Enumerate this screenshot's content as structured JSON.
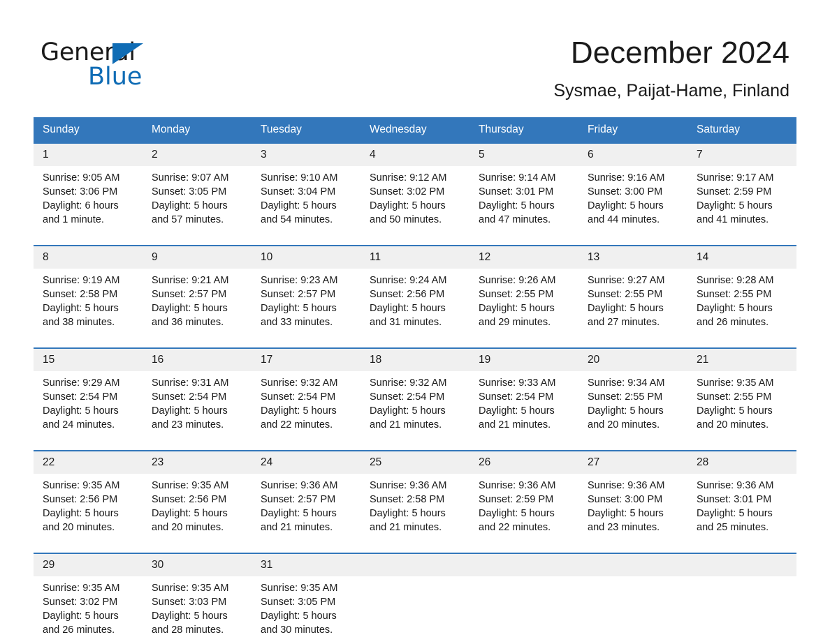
{
  "brand": {
    "name_part1": "General",
    "name_part2": "Blue",
    "triangle_icon": "blue-triangle-icon",
    "accent_color": "#0f6cb5"
  },
  "header": {
    "title": "December 2024",
    "location": "Sysmae, Paijat-Hame, Finland"
  },
  "colors": {
    "header_blue": "#3377bb",
    "daynum_gray": "#f0f0f0",
    "text": "#1a1a1a"
  },
  "calendar": {
    "weekdays": [
      "Sunday",
      "Monday",
      "Tuesday",
      "Wednesday",
      "Thursday",
      "Friday",
      "Saturday"
    ],
    "weeks": [
      [
        {
          "day": "1",
          "sunrise": "Sunrise: 9:05 AM",
          "sunset": "Sunset: 3:06 PM",
          "daylight_line1": "Daylight: 6 hours",
          "daylight_line2": "and 1 minute."
        },
        {
          "day": "2",
          "sunrise": "Sunrise: 9:07 AM",
          "sunset": "Sunset: 3:05 PM",
          "daylight_line1": "Daylight: 5 hours",
          "daylight_line2": "and 57 minutes."
        },
        {
          "day": "3",
          "sunrise": "Sunrise: 9:10 AM",
          "sunset": "Sunset: 3:04 PM",
          "daylight_line1": "Daylight: 5 hours",
          "daylight_line2": "and 54 minutes."
        },
        {
          "day": "4",
          "sunrise": "Sunrise: 9:12 AM",
          "sunset": "Sunset: 3:02 PM",
          "daylight_line1": "Daylight: 5 hours",
          "daylight_line2": "and 50 minutes."
        },
        {
          "day": "5",
          "sunrise": "Sunrise: 9:14 AM",
          "sunset": "Sunset: 3:01 PM",
          "daylight_line1": "Daylight: 5 hours",
          "daylight_line2": "and 47 minutes."
        },
        {
          "day": "6",
          "sunrise": "Sunrise: 9:16 AM",
          "sunset": "Sunset: 3:00 PM",
          "daylight_line1": "Daylight: 5 hours",
          "daylight_line2": "and 44 minutes."
        },
        {
          "day": "7",
          "sunrise": "Sunrise: 9:17 AM",
          "sunset": "Sunset: 2:59 PM",
          "daylight_line1": "Daylight: 5 hours",
          "daylight_line2": "and 41 minutes."
        }
      ],
      [
        {
          "day": "8",
          "sunrise": "Sunrise: 9:19 AM",
          "sunset": "Sunset: 2:58 PM",
          "daylight_line1": "Daylight: 5 hours",
          "daylight_line2": "and 38 minutes."
        },
        {
          "day": "9",
          "sunrise": "Sunrise: 9:21 AM",
          "sunset": "Sunset: 2:57 PM",
          "daylight_line1": "Daylight: 5 hours",
          "daylight_line2": "and 36 minutes."
        },
        {
          "day": "10",
          "sunrise": "Sunrise: 9:23 AM",
          "sunset": "Sunset: 2:57 PM",
          "daylight_line1": "Daylight: 5 hours",
          "daylight_line2": "and 33 minutes."
        },
        {
          "day": "11",
          "sunrise": "Sunrise: 9:24 AM",
          "sunset": "Sunset: 2:56 PM",
          "daylight_line1": "Daylight: 5 hours",
          "daylight_line2": "and 31 minutes."
        },
        {
          "day": "12",
          "sunrise": "Sunrise: 9:26 AM",
          "sunset": "Sunset: 2:55 PM",
          "daylight_line1": "Daylight: 5 hours",
          "daylight_line2": "and 29 minutes."
        },
        {
          "day": "13",
          "sunrise": "Sunrise: 9:27 AM",
          "sunset": "Sunset: 2:55 PM",
          "daylight_line1": "Daylight: 5 hours",
          "daylight_line2": "and 27 minutes."
        },
        {
          "day": "14",
          "sunrise": "Sunrise: 9:28 AM",
          "sunset": "Sunset: 2:55 PM",
          "daylight_line1": "Daylight: 5 hours",
          "daylight_line2": "and 26 minutes."
        }
      ],
      [
        {
          "day": "15",
          "sunrise": "Sunrise: 9:29 AM",
          "sunset": "Sunset: 2:54 PM",
          "daylight_line1": "Daylight: 5 hours",
          "daylight_line2": "and 24 minutes."
        },
        {
          "day": "16",
          "sunrise": "Sunrise: 9:31 AM",
          "sunset": "Sunset: 2:54 PM",
          "daylight_line1": "Daylight: 5 hours",
          "daylight_line2": "and 23 minutes."
        },
        {
          "day": "17",
          "sunrise": "Sunrise: 9:32 AM",
          "sunset": "Sunset: 2:54 PM",
          "daylight_line1": "Daylight: 5 hours",
          "daylight_line2": "and 22 minutes."
        },
        {
          "day": "18",
          "sunrise": "Sunrise: 9:32 AM",
          "sunset": "Sunset: 2:54 PM",
          "daylight_line1": "Daylight: 5 hours",
          "daylight_line2": "and 21 minutes."
        },
        {
          "day": "19",
          "sunrise": "Sunrise: 9:33 AM",
          "sunset": "Sunset: 2:54 PM",
          "daylight_line1": "Daylight: 5 hours",
          "daylight_line2": "and 21 minutes."
        },
        {
          "day": "20",
          "sunrise": "Sunrise: 9:34 AM",
          "sunset": "Sunset: 2:55 PM",
          "daylight_line1": "Daylight: 5 hours",
          "daylight_line2": "and 20 minutes."
        },
        {
          "day": "21",
          "sunrise": "Sunrise: 9:35 AM",
          "sunset": "Sunset: 2:55 PM",
          "daylight_line1": "Daylight: 5 hours",
          "daylight_line2": "and 20 minutes."
        }
      ],
      [
        {
          "day": "22",
          "sunrise": "Sunrise: 9:35 AM",
          "sunset": "Sunset: 2:56 PM",
          "daylight_line1": "Daylight: 5 hours",
          "daylight_line2": "and 20 minutes."
        },
        {
          "day": "23",
          "sunrise": "Sunrise: 9:35 AM",
          "sunset": "Sunset: 2:56 PM",
          "daylight_line1": "Daylight: 5 hours",
          "daylight_line2": "and 20 minutes."
        },
        {
          "day": "24",
          "sunrise": "Sunrise: 9:36 AM",
          "sunset": "Sunset: 2:57 PM",
          "daylight_line1": "Daylight: 5 hours",
          "daylight_line2": "and 21 minutes."
        },
        {
          "day": "25",
          "sunrise": "Sunrise: 9:36 AM",
          "sunset": "Sunset: 2:58 PM",
          "daylight_line1": "Daylight: 5 hours",
          "daylight_line2": "and 21 minutes."
        },
        {
          "day": "26",
          "sunrise": "Sunrise: 9:36 AM",
          "sunset": "Sunset: 2:59 PM",
          "daylight_line1": "Daylight: 5 hours",
          "daylight_line2": "and 22 minutes."
        },
        {
          "day": "27",
          "sunrise": "Sunrise: 9:36 AM",
          "sunset": "Sunset: 3:00 PM",
          "daylight_line1": "Daylight: 5 hours",
          "daylight_line2": "and 23 minutes."
        },
        {
          "day": "28",
          "sunrise": "Sunrise: 9:36 AM",
          "sunset": "Sunset: 3:01 PM",
          "daylight_line1": "Daylight: 5 hours",
          "daylight_line2": "and 25 minutes."
        }
      ],
      [
        {
          "day": "29",
          "sunrise": "Sunrise: 9:35 AM",
          "sunset": "Sunset: 3:02 PM",
          "daylight_line1": "Daylight: 5 hours",
          "daylight_line2": "and 26 minutes."
        },
        {
          "day": "30",
          "sunrise": "Sunrise: 9:35 AM",
          "sunset": "Sunset: 3:03 PM",
          "daylight_line1": "Daylight: 5 hours",
          "daylight_line2": "and 28 minutes."
        },
        {
          "day": "31",
          "sunrise": "Sunrise: 9:35 AM",
          "sunset": "Sunset: 3:05 PM",
          "daylight_line1": "Daylight: 5 hours",
          "daylight_line2": "and 30 minutes."
        },
        {
          "day": "",
          "sunrise": "",
          "sunset": "",
          "daylight_line1": "",
          "daylight_line2": ""
        },
        {
          "day": "",
          "sunrise": "",
          "sunset": "",
          "daylight_line1": "",
          "daylight_line2": ""
        },
        {
          "day": "",
          "sunrise": "",
          "sunset": "",
          "daylight_line1": "",
          "daylight_line2": ""
        },
        {
          "day": "",
          "sunrise": "",
          "sunset": "",
          "daylight_line1": "",
          "daylight_line2": ""
        }
      ]
    ]
  }
}
